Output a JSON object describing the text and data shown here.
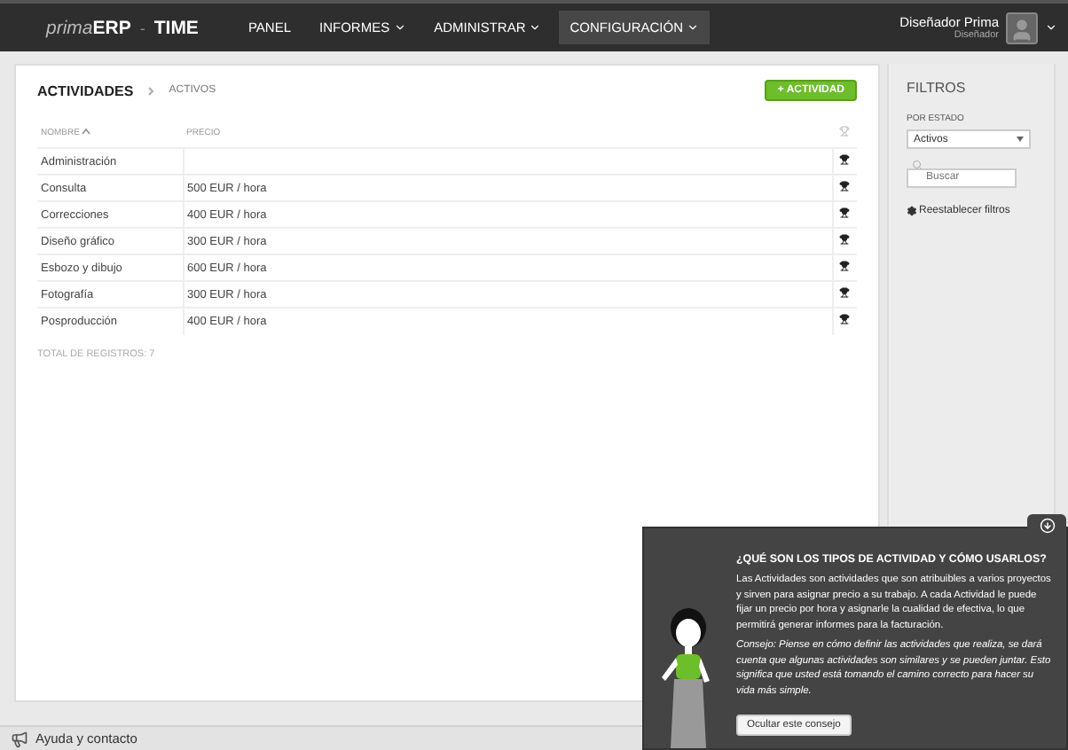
{
  "navbar": {
    "logo": {
      "prefix": "prima",
      "brand": "ERP",
      "separator": "-",
      "product": "TIME"
    },
    "menu": [
      {
        "label": "PANEL",
        "dropdown": false,
        "selected": false
      },
      {
        "label": "INFORMES",
        "dropdown": true,
        "selected": false
      },
      {
        "label": "ADMINISTRAR",
        "dropdown": true,
        "selected": false
      },
      {
        "label": "CONFIGURACIÓN",
        "dropdown": true,
        "selected": true
      }
    ],
    "user": {
      "name": "Diseñador Prima",
      "role": "Diseñador"
    }
  },
  "breadcrumb": [
    "ACTIVIDADES",
    "ACTIVOS"
  ],
  "add_button": "+ ACTIVIDAD",
  "table": {
    "columns": [
      "NOMBRE",
      "PRECIO"
    ],
    "rows": [
      {
        "name": "Administración",
        "price": ""
      },
      {
        "name": "Consulta",
        "price": "500 EUR / hora"
      },
      {
        "name": "Correcciones",
        "price": "400 EUR / hora"
      },
      {
        "name": "Diseño gráfico",
        "price": "300 EUR / hora"
      },
      {
        "name": "Esbozo y dibujo",
        "price": "600 EUR / hora"
      },
      {
        "name": "Fotografía",
        "price": "300 EUR / hora"
      },
      {
        "name": "Posproducción",
        "price": "400 EUR / hora"
      }
    ],
    "total": "TOTAL DE REGISTROS: 7"
  },
  "filters": {
    "title": "FILTROS",
    "status_label": "POR ESTADO",
    "status_value": "Activos",
    "search_placeholder": "Buscar",
    "reset": "Reestablecer filtros"
  },
  "tip": {
    "title": "¿QUÉ SON LOS TIPOS DE ACTIVIDAD Y CÓMO USARLOS?",
    "body": "Las Actividades son actividades que son atribuibles a varios proyectos y sirven para asignar precio a su trabajo. A cada Actividad le puede fijar un precio por hora y asignarle la cualidad de efectiva, lo que permitirá generar informes para la facturación.",
    "advice": "Consejo: Piense en cómo definir las actividades que realiza, se dará cuenta que algunas actividades son similares y se pueden juntar. Esto significa que usted está tomando el camino correcto para hacer su vida más simple.",
    "button": "Ocultar este consejo"
  },
  "help": "Ayuda y contacto"
}
